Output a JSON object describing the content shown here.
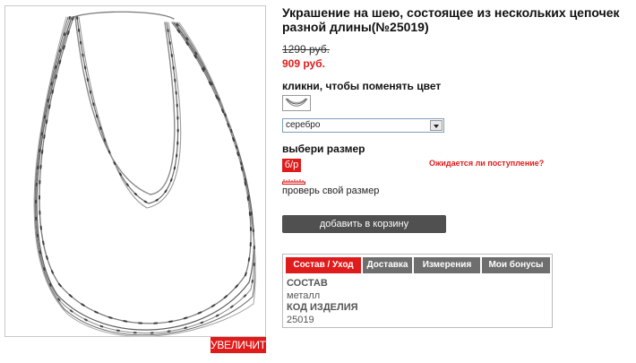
{
  "product": {
    "title": "Украшение на шею, состоящее из нескольких цепочек разной длины(№25019)",
    "old_price": "1299 руб.",
    "new_price": "909 руб.",
    "image_icon": "necklace-image",
    "zoom_label": "УВЕЛИЧИТЬ"
  },
  "color": {
    "label": "кликни, чтобы поменять цвет",
    "swatch_icon": "necklace-swatch-icon",
    "selected": "серебро"
  },
  "size": {
    "label": "выбери размер",
    "options": [
      "б/р"
    ],
    "restock_link": "Ожидается ли поступление?",
    "check_link": "проверь свой размер"
  },
  "cart": {
    "add_label": "добавить в корзину"
  },
  "tabs": {
    "items": [
      {
        "label": "Состав / Уход"
      },
      {
        "label": "Доставка"
      },
      {
        "label": "Измерения"
      },
      {
        "label": "Мои бонусы"
      }
    ],
    "active": "Состав / Уход",
    "content": {
      "composition_head": "СОСТАВ",
      "composition_val": "металл",
      "code_head": "КОД ИЗДЕЛИЯ",
      "code_val": "25019"
    }
  },
  "colors": {
    "accent": "#e01b1b",
    "button": "#505050",
    "tab_inactive": "#6e6e6e"
  }
}
